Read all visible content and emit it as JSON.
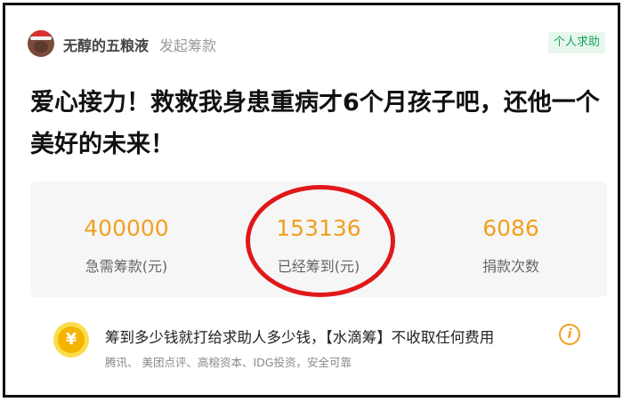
{
  "header": {
    "user_name": "无醇的五粮液",
    "action": "发起筹款",
    "tag": "个人求助"
  },
  "title": "爱心接力！救救我身患重病才6个月孩子吧，还他一个美好的未来！",
  "stats": [
    {
      "value": "400000",
      "label": "急需筹款(元)"
    },
    {
      "value": "153136",
      "label": "已经筹到(元)"
    },
    {
      "value": "6086",
      "label": "捐款次数"
    }
  ],
  "notice": {
    "coin_symbol": "¥",
    "promise": "筹到多少钱就打给求助人多少钱，【水滴筹】不收取任何费用",
    "backers": "腾讯、 美团点评、高榕资本、IDG投资，安全可靠",
    "info_symbol": "i"
  },
  "colors": {
    "accent": "#f0a020",
    "tag_green": "#1aa25c",
    "highlight_red": "#e01818"
  }
}
